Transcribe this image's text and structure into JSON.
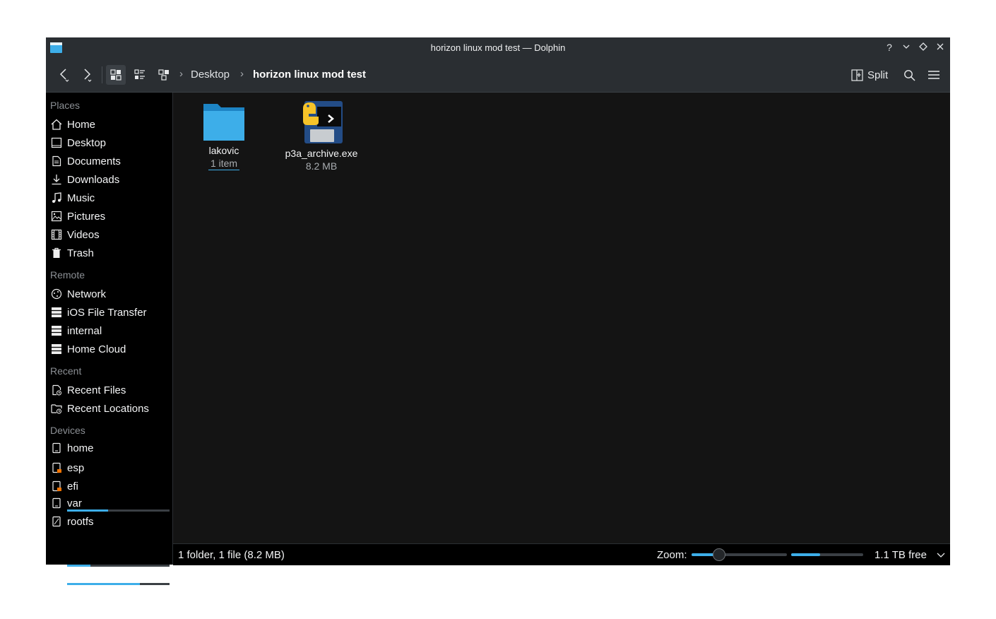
{
  "window": {
    "title": "horizon linux mod test — Dolphin"
  },
  "titlebar": {
    "help": "?",
    "minimize": "⌄",
    "maximize": "◇",
    "close": "✕"
  },
  "toolbar": {
    "breadcrumb": [
      {
        "label": "Desktop"
      },
      {
        "label": "horizon linux mod test"
      }
    ],
    "split_label": "Split"
  },
  "sidebar": {
    "places_header": "Places",
    "places": [
      {
        "label": "Home",
        "icon": "home-icon"
      },
      {
        "label": "Desktop",
        "icon": "desktop-icon"
      },
      {
        "label": "Documents",
        "icon": "documents-icon"
      },
      {
        "label": "Downloads",
        "icon": "downloads-icon"
      },
      {
        "label": "Music",
        "icon": "music-icon"
      },
      {
        "label": "Pictures",
        "icon": "pictures-icon"
      },
      {
        "label": "Videos",
        "icon": "videos-icon"
      },
      {
        "label": "Trash",
        "icon": "trash-icon"
      }
    ],
    "remote_header": "Remote",
    "remote": [
      {
        "label": "Network",
        "icon": "network-icon"
      },
      {
        "label": "iOS File Transfer",
        "icon": "drive-icon"
      },
      {
        "label": "internal",
        "icon": "drive-icon"
      },
      {
        "label": "Home Cloud",
        "icon": "drive-icon"
      }
    ],
    "recent_header": "Recent",
    "recent": [
      {
        "label": "Recent Files",
        "icon": "recent-files-icon"
      },
      {
        "label": "Recent Locations",
        "icon": "recent-locations-icon"
      }
    ],
    "devices_header": "Devices",
    "devices": [
      {
        "label": "home",
        "icon": "disk-icon",
        "usage": 0.4
      },
      {
        "label": "esp",
        "icon": "locked-disk-icon"
      },
      {
        "label": "efi",
        "icon": "locked-disk-icon"
      },
      {
        "label": "var",
        "icon": "disk-icon",
        "usage": 0.23
      },
      {
        "label": "rootfs",
        "icon": "rootfs-disk-icon",
        "usage": 0.71
      }
    ]
  },
  "files": [
    {
      "name": "lakovic",
      "meta": "1 item",
      "type": "folder",
      "icon": "folder-icon"
    },
    {
      "name": "p3a_archive.exe",
      "meta": "8.2 MB",
      "type": "executable",
      "icon": "python-executable-icon"
    }
  ],
  "statusbar": {
    "summary": "1 folder, 1 file (8.2 MB)",
    "zoom_label": "Zoom:",
    "zoom_level": 0.28,
    "space_used": 0.4,
    "free_space": "1.1 TB free"
  },
  "colors": {
    "accent": "#3daee9",
    "window_bg": "#141414",
    "chrome_bg": "#2a2e32",
    "sidebar_bg": "#000000"
  }
}
